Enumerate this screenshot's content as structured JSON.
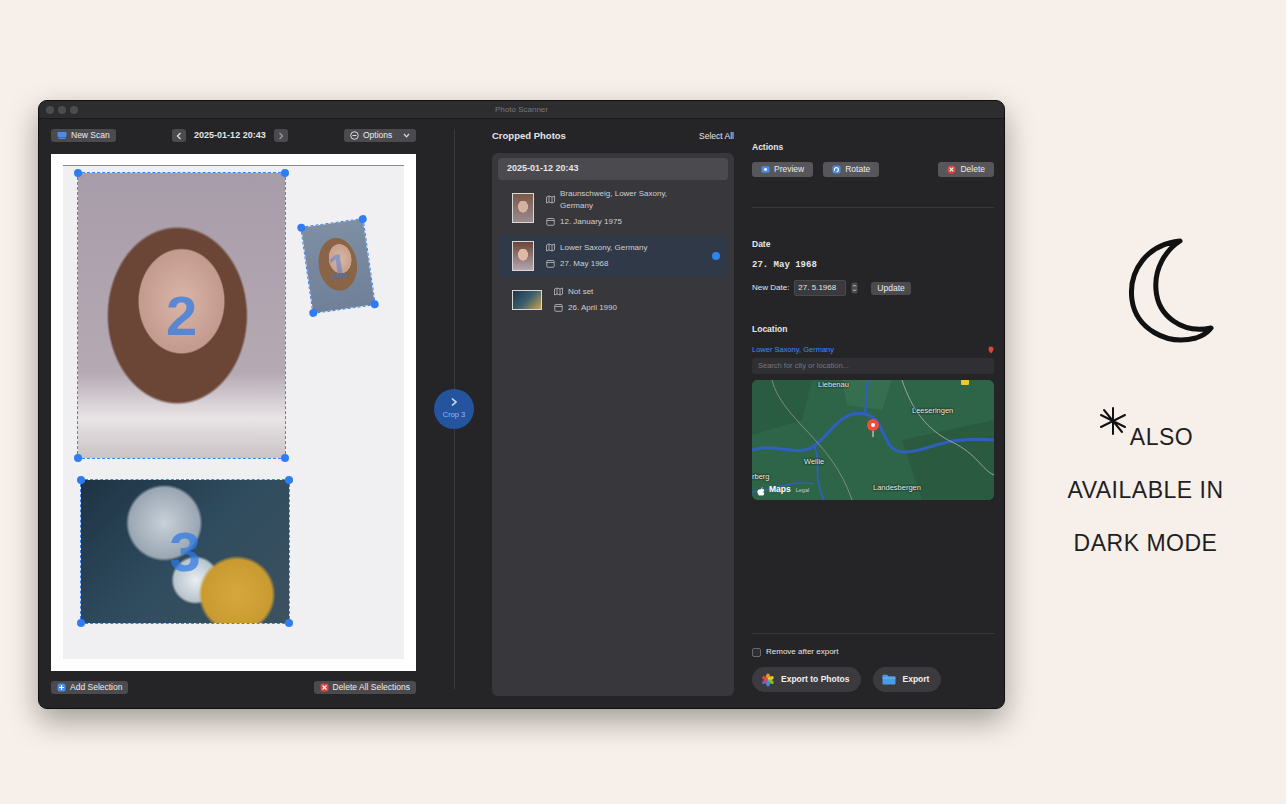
{
  "window": {
    "title": "Photo Scanner"
  },
  "scan_toolbar": {
    "new_scan": "New Scan",
    "date": "2025-01-12 20:43",
    "options": "Options"
  },
  "scan": {
    "selections": [
      {
        "number": "2"
      },
      {
        "number": "1"
      },
      {
        "number": "3"
      }
    ]
  },
  "scan_buttons": {
    "add": "Add Selection",
    "delete_all": "Delete All Selections"
  },
  "crop_button": {
    "label": "Crop 3"
  },
  "cropped": {
    "title": "Cropped Photos",
    "select_all": "Select All",
    "groups": [
      {
        "label": "2025-01-12 20:43",
        "items": [
          {
            "location": "Braunschweig, Lower Saxony, Germany",
            "date": "12. January 1975",
            "selected": false
          },
          {
            "location": "Lower Saxony, Germany",
            "date": "27. May 1968",
            "selected": true
          },
          {
            "location": "Not set",
            "date": "26. April 1990",
            "selected": false
          }
        ]
      }
    ]
  },
  "details": {
    "actions_title": "Actions",
    "actions": [
      {
        "label": "Preview",
        "kind": "preview"
      },
      {
        "label": "Rotate",
        "kind": "rotate"
      },
      {
        "label": "Delete",
        "kind": "delete"
      }
    ],
    "date_title": "Date",
    "date": "27. May 1968",
    "new_date_label": "New Date:",
    "new_date_value": "27. 5.1968",
    "update": "Update",
    "location_title": "Location",
    "location": "Lower Saxony, Germany",
    "search_placeholder": "Search for city or location...",
    "map": {
      "labels": [
        "Liebenau",
        "Leeseringen",
        "Wellie",
        "Landesbergen",
        "rberg"
      ],
      "logo": "Maps",
      "legal": "Legal"
    }
  },
  "export": {
    "remove_after_export": {
      "label": "Remove after export",
      "checked": false
    },
    "buttons": [
      {
        "label": "Export to Photos",
        "kind": "photos"
      },
      {
        "label": "Export",
        "kind": "folder"
      }
    ]
  },
  "promo": {
    "lines": [
      "ALSO",
      "AVAILABLE IN",
      "DARK MODE"
    ]
  }
}
